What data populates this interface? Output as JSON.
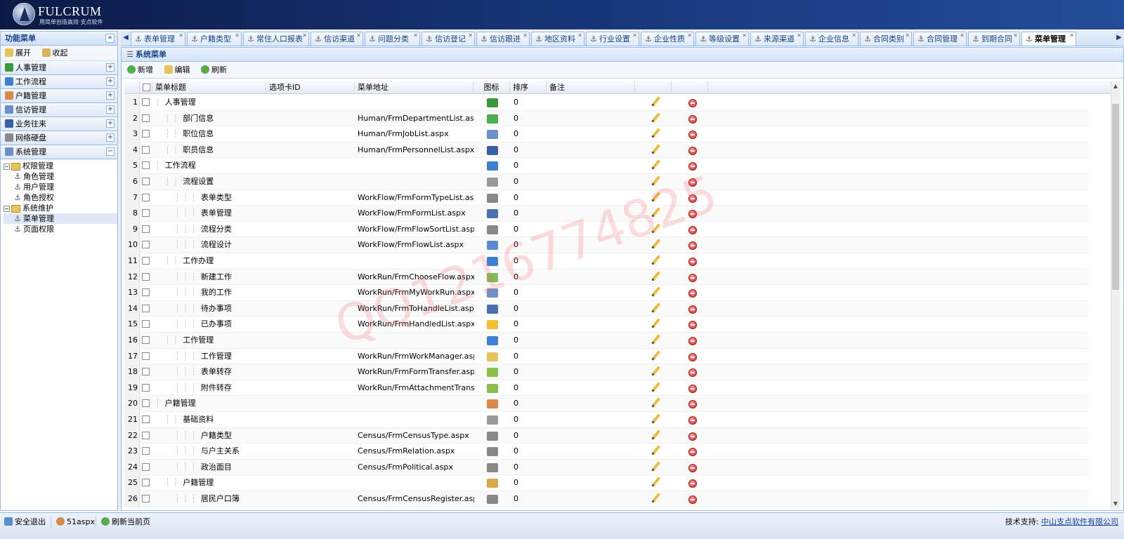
{
  "brand": {
    "name": "FULCRUM",
    "slogan": "用简单创造高效·支点软件"
  },
  "left": {
    "title": "功能菜单",
    "expand": "展开",
    "collapse": "收起",
    "sections": [
      "人事管理",
      "工作流程",
      "户籍管理",
      "信访管理",
      "业务往来",
      "网络硬盘",
      "系统管理"
    ],
    "tree": [
      {
        "label": "权限管理",
        "level": 0,
        "type": "folder"
      },
      {
        "label": "角色管理",
        "level": 1,
        "type": "leaf"
      },
      {
        "label": "用户管理",
        "level": 1,
        "type": "leaf"
      },
      {
        "label": "角色授权",
        "level": 1,
        "type": "leaf"
      },
      {
        "label": "系统维护",
        "level": 0,
        "type": "folder"
      },
      {
        "label": "菜单管理",
        "level": 1,
        "type": "leaf",
        "selected": true
      },
      {
        "label": "页面权限",
        "level": 1,
        "type": "leaf"
      }
    ]
  },
  "tabs": [
    {
      "label": "表单管理"
    },
    {
      "label": "户籍类型"
    },
    {
      "label": "常住人口报表"
    },
    {
      "label": "信访渠道"
    },
    {
      "label": "问题分类"
    },
    {
      "label": "信访登记"
    },
    {
      "label": "信访跟进"
    },
    {
      "label": "地区资料"
    },
    {
      "label": "行业设置"
    },
    {
      "label": "企业性质"
    },
    {
      "label": "等级设置"
    },
    {
      "label": "来源渠道"
    },
    {
      "label": "企业信息"
    },
    {
      "label": "合同类别"
    },
    {
      "label": "合同管理"
    },
    {
      "label": "到期合同"
    },
    {
      "label": "菜单管理",
      "active": true
    }
  ],
  "main": {
    "title": "系统菜单",
    "toolbar": {
      "add": "新增",
      "edit": "编辑",
      "refresh": "刷新"
    },
    "columns": [
      "菜单标题",
      "选项卡ID",
      "菜单地址",
      "图标",
      "排序",
      "备注"
    ],
    "rows": [
      {
        "n": "1",
        "title": "人事管理",
        "depth": 0,
        "url": "",
        "sort": "0",
        "icon": "#3a9a3a"
      },
      {
        "n": "2",
        "title": "部门信息",
        "depth": 1,
        "url": "Human/FrmDepartmentList.aspx",
        "sort": "0",
        "icon": "#4caf50"
      },
      {
        "n": "3",
        "title": "职位信息",
        "depth": 1,
        "url": "Human/FrmJobList.aspx",
        "sort": "0",
        "icon": "#6d8fc7"
      },
      {
        "n": "4",
        "title": "职员信息",
        "depth": 1,
        "url": "Human/FrmPersonnelList.aspx",
        "sort": "0",
        "icon": "#3b5ea8"
      },
      {
        "n": "5",
        "title": "工作流程",
        "depth": 0,
        "url": "",
        "sort": "0",
        "icon": "#3f7fd0"
      },
      {
        "n": "6",
        "title": "流程设置",
        "depth": 1,
        "url": "",
        "sort": "0",
        "icon": "#9a9a9a"
      },
      {
        "n": "7",
        "title": "表单类型",
        "depth": 2,
        "url": "WorkFlow/FrmFormTypeList.aspx",
        "sort": "0",
        "icon": "#888888"
      },
      {
        "n": "8",
        "title": "表单管理",
        "depth": 2,
        "url": "WorkFlow/FrmFormList.aspx",
        "sort": "0",
        "icon": "#4b6fb0"
      },
      {
        "n": "9",
        "title": "流程分类",
        "depth": 2,
        "url": "WorkFlow/FrmFlowSortList.aspx",
        "sort": "0",
        "icon": "#888888"
      },
      {
        "n": "10",
        "title": "流程设计",
        "depth": 2,
        "url": "WorkFlow/FrmFlowList.aspx",
        "sort": "0",
        "icon": "#5a8ad0"
      },
      {
        "n": "11",
        "title": "工作办理",
        "depth": 1,
        "url": "",
        "sort": "0",
        "icon": "#3f7fd0"
      },
      {
        "n": "12",
        "title": "新建工作",
        "depth": 2,
        "url": "WorkRun/FrmChooseFlow.aspx",
        "sort": "0",
        "icon": "#7fbf5a"
      },
      {
        "n": "13",
        "title": "我的工作",
        "depth": 2,
        "url": "WorkRun/FrmMyWorkRun.aspx",
        "sort": "0",
        "icon": "#6d8fc7"
      },
      {
        "n": "14",
        "title": "待办事项",
        "depth": 2,
        "url": "WorkRun/FrmToHandleList.aspx",
        "sort": "0",
        "icon": "#4b6fb0"
      },
      {
        "n": "15",
        "title": "已办事项",
        "depth": 2,
        "url": "WorkRun/FrmHandledList.aspx",
        "sort": "0",
        "icon": "#f2c12e"
      },
      {
        "n": "16",
        "title": "工作管理",
        "depth": 1,
        "url": "",
        "sort": "0",
        "icon": "#3f7fd0"
      },
      {
        "n": "17",
        "title": "工作管理",
        "depth": 2,
        "url": "WorkRun/FrmWorkManager.aspx",
        "sort": "0",
        "icon": "#e7c45a"
      },
      {
        "n": "18",
        "title": "表单转存",
        "depth": 2,
        "url": "WorkRun/FrmFormTransfer.aspx",
        "sort": "0",
        "icon": "#8bbf4a"
      },
      {
        "n": "19",
        "title": "附件转存",
        "depth": 2,
        "url": "WorkRun/FrmAttachmentTransfer...",
        "sort": "0",
        "icon": "#8bbf4a"
      },
      {
        "n": "20",
        "title": "户籍管理",
        "depth": 0,
        "url": "",
        "sort": "0",
        "icon": "#d9894a"
      },
      {
        "n": "21",
        "title": "基础资料",
        "depth": 1,
        "url": "",
        "sort": "0",
        "icon": "#9a9a9a"
      },
      {
        "n": "22",
        "title": "户籍类型",
        "depth": 2,
        "url": "Census/FrmCensusType.aspx",
        "sort": "0",
        "icon": "#888888"
      },
      {
        "n": "23",
        "title": "与户主关系",
        "depth": 2,
        "url": "Census/FrmRelation.aspx",
        "sort": "0",
        "icon": "#888888"
      },
      {
        "n": "24",
        "title": "政治面目",
        "depth": 2,
        "url": "Census/FrmPolitical.aspx",
        "sort": "0",
        "icon": "#888888"
      },
      {
        "n": "25",
        "title": "户籍管理",
        "depth": 1,
        "url": "",
        "sort": "0",
        "icon": "#d9a84a"
      },
      {
        "n": "26",
        "title": "居民户口簿",
        "depth": 2,
        "url": "Census/FrmCensusRegister.aspx",
        "sort": "0",
        "icon": "#888888"
      }
    ]
  },
  "watermark": "QQ1216774825",
  "status": {
    "logout": "安全退出",
    "user": "51aspx",
    "refresh": "刷新当前页",
    "support_label": "技术支持:",
    "support_company": "中山支点软件有限公司"
  }
}
